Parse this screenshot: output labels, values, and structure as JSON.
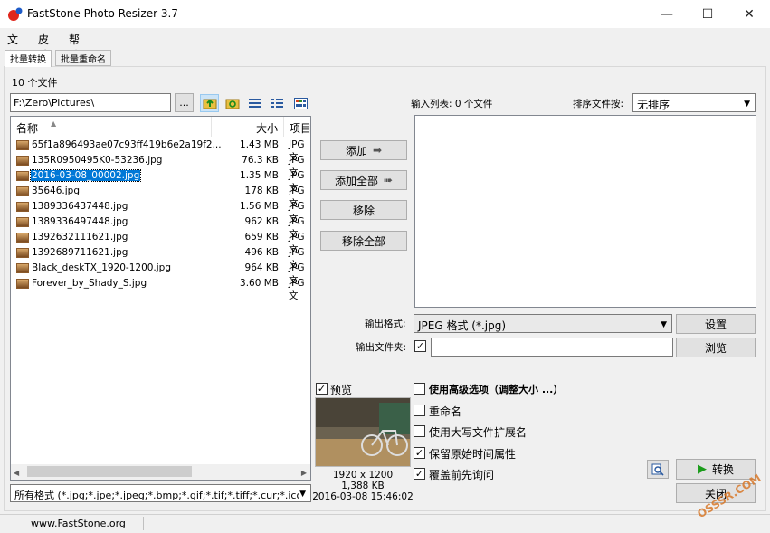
{
  "window": {
    "title": "FastStone Photo Resizer 3.7",
    "minimize": "—",
    "maximize": "☐",
    "close": "✕"
  },
  "menu": [
    "文件",
    "皮肤",
    "帮助"
  ],
  "tabs": [
    "批量转换",
    "批量重命名"
  ],
  "file_count": "10 个文件",
  "path": "F:\\Zero\\Pictures\\",
  "browse_dots": "...",
  "columns": {
    "name": "名称",
    "size": "大小",
    "type": "项目"
  },
  "files": [
    {
      "name": "65f1a896493ae07c93ff419b6e2a19f2...",
      "size": "1.43 MB",
      "type": "JPG 文"
    },
    {
      "name": "135R0950495K0-53236.jpg",
      "size": "76.3 KB",
      "type": "JPG 文"
    },
    {
      "name": "2016-03-08_00002.jpg",
      "size": "1.35 MB",
      "type": "JPG 文"
    },
    {
      "name": "35646.jpg",
      "size": "178 KB",
      "type": "JPG 文"
    },
    {
      "name": "1389336437448.jpg",
      "size": "1.56 MB",
      "type": "JPG 文"
    },
    {
      "name": "1389336497448.jpg",
      "size": "962 KB",
      "type": "JPG 文"
    },
    {
      "name": "1392632111621.jpg",
      "size": "659 KB",
      "type": "JPG 文"
    },
    {
      "name": "1392689711621.jpg",
      "size": "496 KB",
      "type": "JPG 文"
    },
    {
      "name": "Black_deskTX_1920-1200.jpg",
      "size": "964 KB",
      "type": "JPG 文"
    },
    {
      "name": "Forever_by_Shady_S.jpg",
      "size": "3.60 MB",
      "type": "JPG 文"
    }
  ],
  "filter": "所有格式 (*.jpg;*.jpe;*.jpeg;*.bmp;*.gif;*.tif;*.tiff;*.cur;*.ico",
  "buttons": {
    "add": "添加",
    "add_all": "添加全部",
    "remove": "移除",
    "remove_all": "移除全部",
    "settings": "设置",
    "browse": "浏览",
    "convert": "转换",
    "close": "关闭"
  },
  "input_list_label": "输入列表: 0 个文件",
  "sort_label": "排序文件按:",
  "sort_value": "无排序",
  "output_format_label": "输出格式:",
  "output_format_value": "JPEG 格式 (*.jpg)",
  "output_folder_label": "输出文件夹:",
  "output_folder_value": "",
  "preview": {
    "label": "预览",
    "checked": true,
    "dimensions": "1920 x 1200",
    "filesize": "1,388 KB",
    "datetime": "2016-03-08 15:46:02"
  },
  "options": [
    {
      "label": "使用高级选项（调整大小 ...）",
      "checked": false
    },
    {
      "label": "重命名",
      "checked": false
    },
    {
      "label": "使用大写文件扩展名",
      "checked": false
    },
    {
      "label": "保留原始时间属性",
      "checked": true
    },
    {
      "label": "覆盖前先询问",
      "checked": true
    }
  ],
  "status": "www.FastStone.org",
  "watermark": "OSSSR.COM",
  "colors": {
    "selection": "#0078d7",
    "convert_arrow": "#1a9c1a",
    "title_logo_red": "#e0261c",
    "title_logo_blue": "#1e5cc8"
  }
}
